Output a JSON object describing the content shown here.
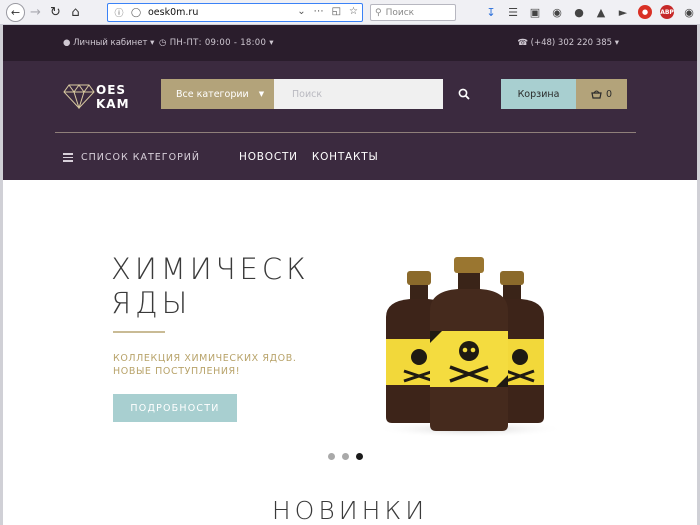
{
  "browser": {
    "url": "oesk0m.ru",
    "search_placeholder": "Поиск"
  },
  "topbar": {
    "account": "Личный кабинет",
    "hours": "ПН-ПТ: 09:00 - 18:00",
    "phone": "(+48) 302 220 385"
  },
  "header": {
    "logo_line1": "OES",
    "logo_line2": "KAM",
    "categories_button": "Все категории",
    "search_placeholder": "Поиск",
    "cart_label": "Корзина",
    "cart_count": "0",
    "category_list": "СПИСОК КАТЕГОРИЙ",
    "menu": [
      "НОВОСТИ",
      "КОНТАКТЫ"
    ]
  },
  "hero": {
    "title": "ХИМИЧЕСКИЕ\nЯДЫ",
    "subtitle": "КОЛЛЕКЦИЯ ХИМИЧЕСКИХ ЯДОВ.\nНОВЫЕ ПОСТУПЛЕНИЯ!",
    "button": "ПОДРОБНОСТИ"
  },
  "section": {
    "title": "НОВИНКИ"
  },
  "colors": {
    "topbar": "#2a1d2c",
    "header": "#3b2a3f",
    "gold": "#b3a37a",
    "teal": "#a8cfd0"
  }
}
